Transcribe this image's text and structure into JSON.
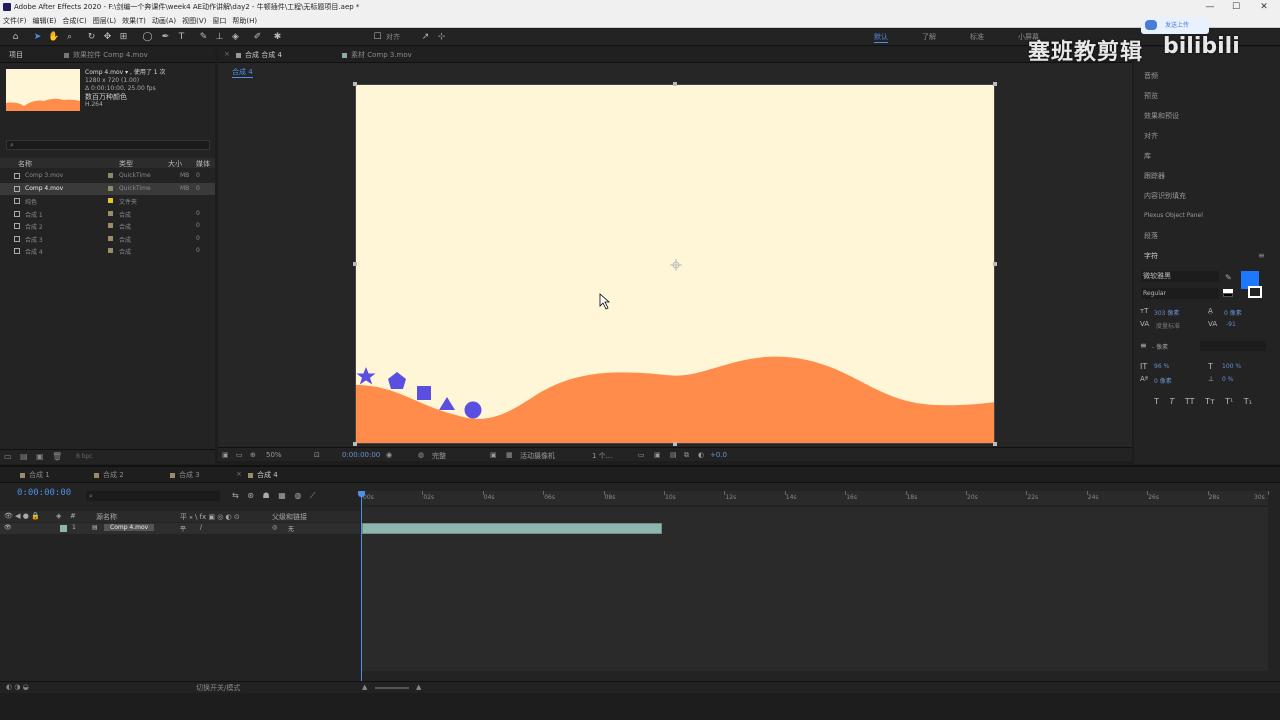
{
  "window": {
    "title": "Adobe After Effects 2020 - F:\\剑编一个奔课件\\week4 AE动作讲解\\day2 - 牛顿插件\\工程\\无标题项目.aep *",
    "controls": [
      "—",
      "☐",
      "✕"
    ]
  },
  "menu": [
    "文件(F)",
    "编辑(E)",
    "合成(C)",
    "图层(L)",
    "效果(T)",
    "动画(A)",
    "视图(V)",
    "窗口",
    "帮助(H)"
  ],
  "toolbar": {
    "snap_label": "对齐",
    "workspaces": [
      "默认",
      "了解",
      "标准",
      "小屏幕"
    ],
    "active_workspace": "默认"
  },
  "project_panel": {
    "tabs": [
      "项目",
      "效果控件 Comp 4.mov"
    ],
    "selected_item": {
      "name": "Comp 4.mov",
      "used": "▾ , 使用了 1 次",
      "dimensions": "1280 x 720 (1.00)",
      "duration": "Δ 0:00:10:00, 25.00 fps",
      "colors": "数百万种颜色",
      "codec": "H.264"
    },
    "search_placeholder": "⌕",
    "columns": [
      "名称",
      "类型",
      "大小",
      "媒体"
    ],
    "rows": [
      {
        "name": "Comp 3.mov",
        "type": "QuickTime",
        "size": "MB",
        "frames": "0",
        "label_color": "#8a8a6a",
        "selected": false
      },
      {
        "name": "Comp 4.mov",
        "type": "QuickTime",
        "size": "MB",
        "frames": "0",
        "label_color": "#8a8a6a",
        "selected": true
      },
      {
        "name": "纯色",
        "type": "文件夹",
        "size": "",
        "frames": "",
        "label_color": "#e2c531",
        "selected": false
      },
      {
        "name": "合成 1",
        "type": "合成",
        "size": "",
        "frames": "0",
        "label_color": "#9c8b6a",
        "selected": false
      },
      {
        "name": "合成 2",
        "type": "合成",
        "size": "",
        "frames": "0",
        "label_color": "#9c8b6a",
        "selected": false
      },
      {
        "name": "合成 3",
        "type": "合成",
        "size": "",
        "frames": "0",
        "label_color": "#9c8b6a",
        "selected": false
      },
      {
        "name": "合成 4",
        "type": "合成",
        "size": "",
        "frames": "0",
        "label_color": "#9c8b6a",
        "selected": false
      }
    ],
    "bpc": "8 bpc"
  },
  "comp_panel": {
    "tabs": [
      "合成 合成 4",
      "素材 Comp 3.mov"
    ],
    "breadcrumb": "合成 4",
    "canvas_bg": "#fff6d8",
    "wave_color": "#ff8c4a",
    "shape_color": "#5a4fe0",
    "viewer": {
      "zoom": "50%",
      "timecode": "0:00:00:00",
      "resolution": "完整",
      "camera": "活动摄像机",
      "views": "1 个...",
      "exposure": "+0.0"
    }
  },
  "right_panel": {
    "items": [
      "音频",
      "预览",
      "效果和预设",
      "对齐",
      "库",
      "跟踪器",
      "内容识别填充",
      "Plexus Object Panel",
      "段落",
      "字符"
    ],
    "character": {
      "font": "微软雅黑",
      "style": "Regular",
      "size": "303 像素",
      "leading": "0 像素",
      "tracking_label": "度量标准",
      "tracking": "-91",
      "stroke": "- 像素",
      "vscale": "96 %",
      "hscale": "100 %",
      "baseline": "0 像素",
      "tsume": "0 %",
      "fill_color": "#1e78ff",
      "styles": [
        "T",
        "T",
        "TT",
        "Tт",
        "T¹",
        "T₁"
      ]
    }
  },
  "timeline": {
    "tabs": [
      "合成 1",
      "合成 2",
      "合成 3",
      "合成 4"
    ],
    "active_tab": "合成 4",
    "timecode": "0:00:00:00",
    "search_placeholder": "⌕",
    "ruler": [
      "00s",
      "02s",
      "04s",
      "06s",
      "08s",
      "10s",
      "12s",
      "14s",
      "16s",
      "18s",
      "20s",
      "22s",
      "24s",
      "26s",
      "28s",
      "30s"
    ],
    "columns": {
      "source": "源名称",
      "parent": "父级和链接"
    },
    "layer": {
      "index": "1",
      "name": "Comp 4.mov",
      "parent": "无"
    },
    "status": "切换开关/模式"
  },
  "watermark": {
    "text": "塞班教剪辑",
    "logo": "bilibili",
    "upload": "发送上传"
  }
}
